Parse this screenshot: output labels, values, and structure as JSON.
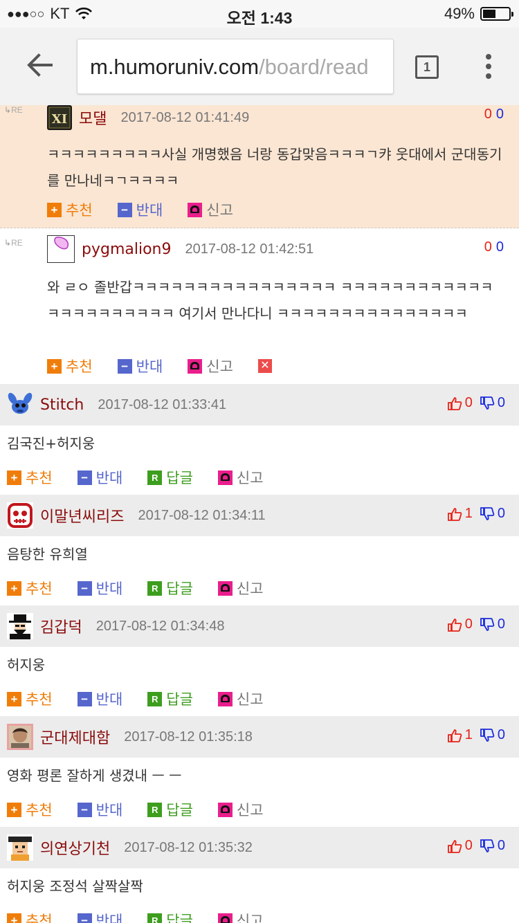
{
  "status": {
    "carrier": "KT",
    "signal": "●●●○○",
    "time": "오전 1:43",
    "battery": "49%",
    "battery_level": 0.49
  },
  "browser": {
    "url_host": "m.humoruniv.com",
    "url_path": "/board/read",
    "tab_count": "1"
  },
  "actions": {
    "recommend": "추천",
    "oppose": "반대",
    "reply": "답글",
    "report": "신고",
    "reply_icon": "R",
    "delete_icon": "✕"
  },
  "replies": [
    {
      "re_label": "RE",
      "nick": "모댈",
      "date": "2017-08-12 01:41:49",
      "up": "0",
      "down": "0",
      "text": "ㅋㅋㅋㅋㅋㅋㅋㅋㅋ사실 개명했음 너랑 동갑맞음ㅋㅋㅋㄱ캬 웃대에서 군대동기를 만나네ㅋㄱㅋㅋㅋㅋ"
    },
    {
      "re_label": "RE",
      "nick": "pygmalion9",
      "date": "2017-08-12 01:42:51",
      "up": "0",
      "down": "0",
      "text": "와 ㄹㅇ 졸반갑ㅋㅋㅋㅋㅋㅋㅋㅋㅋㅋㅋㅋㅋㅋㅋㅋ ㅋㅋㅋㅋㅋㅋㅋㅋㅋㅋㅋㅋㅋㅋㅋㅋㅋㅋㅋㅋㅋㅋ 여기서 만나다니 ㅋㅋㅋㅋㅋㅋㅋㅋㅋㅋㅋㅋㅋㅋㅋ"
    }
  ],
  "comments": [
    {
      "nick": "Stitch",
      "date": "2017-08-12 01:33:41",
      "up": "0",
      "down": "0",
      "text": "김국진+허지웅"
    },
    {
      "nick": "이말년씨리즈",
      "date": "2017-08-12 01:34:11",
      "up": "1",
      "down": "0",
      "text": "음탕한 유희열"
    },
    {
      "nick": "김갑덕",
      "date": "2017-08-12 01:34:48",
      "up": "0",
      "down": "0",
      "text": "허지웅"
    },
    {
      "nick": "군대제대함",
      "date": "2017-08-12 01:35:18",
      "up": "1",
      "down": "0",
      "text": "영화 평론 잘하게 생겼내 ㅡ ㅡ"
    },
    {
      "nick": "의연상기천",
      "date": "2017-08-12 01:35:32",
      "up": "0",
      "down": "0",
      "text": "허지웅 조정석 살짝살짝"
    }
  ],
  "colors": {
    "nick": "#8a0b0b",
    "highlight_bg": "#fbe6d3",
    "recommend": "#f07d0a",
    "oppose": "#5566cc",
    "reply": "#3d9e1e",
    "report": "#e91e8c"
  }
}
